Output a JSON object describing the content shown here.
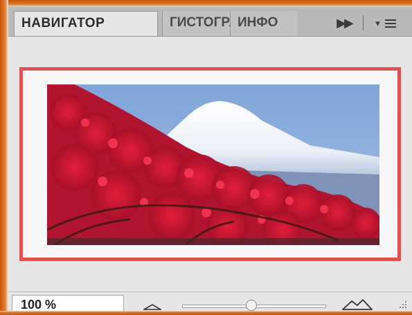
{
  "panel": {
    "tabs": [
      {
        "label": "НАВИГАТОР",
        "active": true
      },
      {
        "label": "ГИСТОГРАММА",
        "active": false
      },
      {
        "label": "ИНФО",
        "active": false
      }
    ],
    "expand_icon": "double-chevron-right-icon",
    "menu_icon": "panel-menu-icon"
  },
  "preview": {
    "highlight_color": "#e05050",
    "image_subject": "mountain-with-red-blossoms"
  },
  "zoom": {
    "value": "100 %",
    "slider_level_percent": 48,
    "zoom_out_icon": "small-mountain-icon",
    "zoom_in_icon": "large-mountain-icon"
  }
}
